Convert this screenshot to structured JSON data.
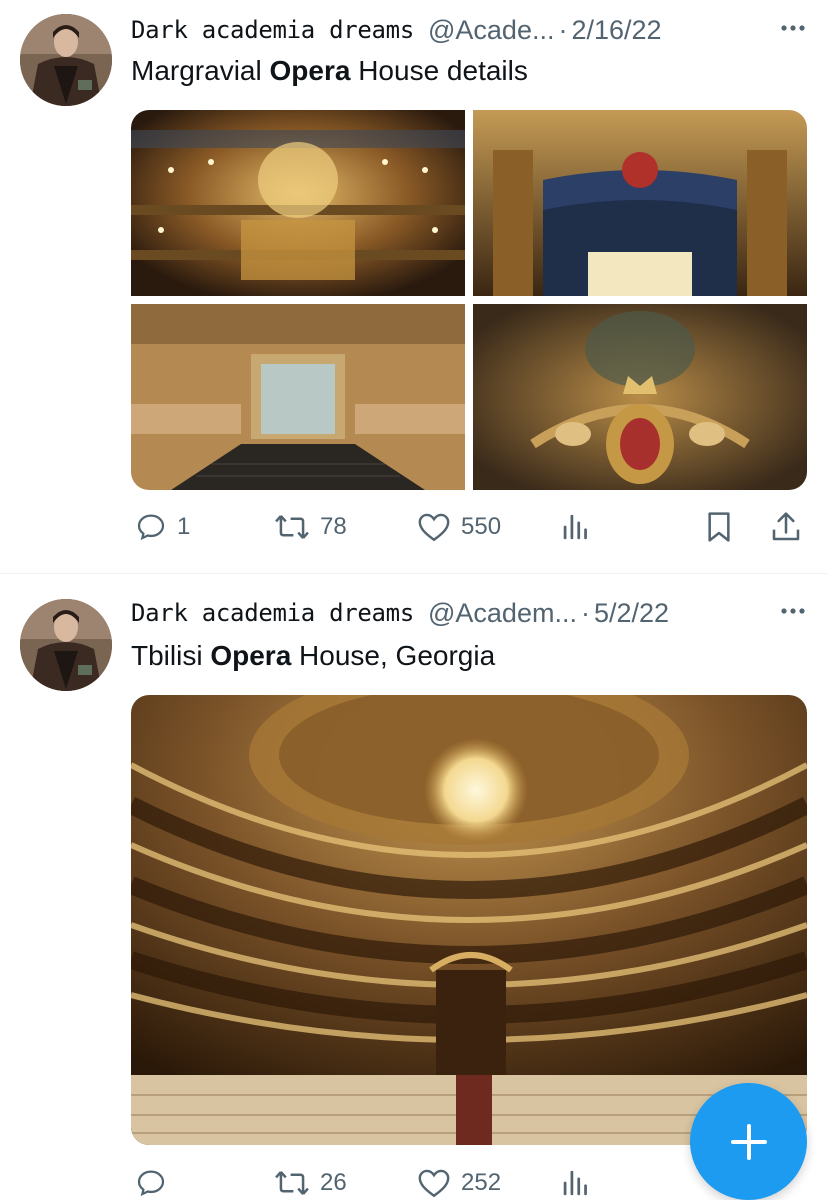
{
  "colors": {
    "accent": "#1d9bf0",
    "muted": "#536471",
    "text": "#0f1419",
    "separator": "#eff3f4"
  },
  "tweets": [
    {
      "name": "Dark academia dreams",
      "handle": "@Acade...",
      "dot": "·",
      "date": "2/16/22",
      "text_pre": "Margravial ",
      "text_bold": "Opera",
      "text_post": " House details",
      "media_count": 4,
      "stats": {
        "replies": "1",
        "retweets": "78",
        "likes": "550"
      }
    },
    {
      "name": "Dark academia dreams",
      "handle": "@Academ...",
      "dot": "·",
      "date": "5/2/22",
      "text_pre": "Tbilisi ",
      "text_bold": "Opera",
      "text_post": " House, Georgia",
      "media_count": 1,
      "stats": {
        "replies": "",
        "retweets": "26",
        "likes": "252"
      }
    }
  ],
  "icons": {
    "more": "more-horizontal-icon",
    "reply": "reply-icon",
    "retweet": "retweet-icon",
    "like": "heart-icon",
    "views": "views-chart-icon",
    "bookmark": "bookmark-icon",
    "share": "share-icon",
    "compose": "plus-icon"
  }
}
